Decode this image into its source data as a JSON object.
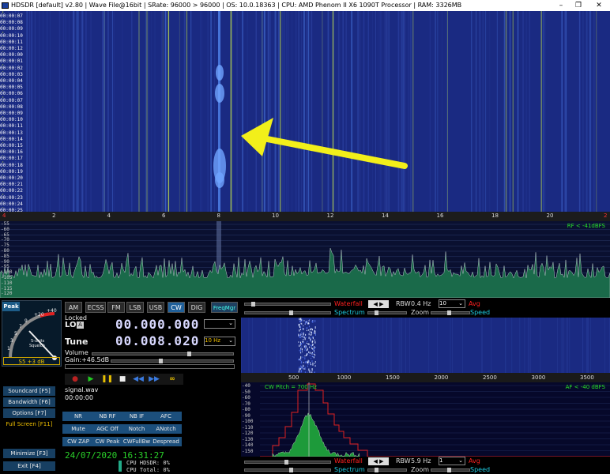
{
  "titlebar": {
    "title": "HDSDR  [default]  v2.80  |  Wave File@16bit  |  SRate: 96000 > 96000  |  OS: 10.0.18363  |  CPU: AMD Phenom II X6 1090T Processor  |  RAM: 3326MB",
    "min": "–",
    "max": "❐",
    "close": "✕"
  },
  "waterfall": {
    "timestamps": [
      "00:00:07",
      "00:00:08",
      "00:00:09",
      "00:00:10",
      "00:00:11",
      "00:00:12",
      "00:00:00",
      "00:00:01",
      "00:00:02",
      "00:00:03",
      "00:00:04",
      "00:00:05",
      "00:00:06",
      "00:00:07",
      "00:00:08",
      "00:00:09",
      "00:00:10",
      "00:00:11",
      "00:00:13",
      "00:00:14",
      "00:00:15",
      "00:00:16",
      "00:00:17",
      "00:00:18",
      "00:00:19",
      "00:00:20",
      "00:00:21",
      "00:00:22",
      "00:00:23",
      "00:00:24",
      "00:00:25"
    ],
    "freq_ticks": [
      "2",
      "4",
      "6",
      "8",
      "10",
      "12",
      "14",
      "16",
      "18",
      "20"
    ],
    "left_marker": "4",
    "right_marker": "2"
  },
  "spectrum": {
    "db_labels": [
      "-55",
      "-60",
      "-65",
      "-70",
      "-75",
      "-80",
      "-85",
      "-90",
      "-95",
      "-100",
      "-105",
      "-110",
      "-115",
      "-120"
    ],
    "rf_info": "RF < -41dBFS"
  },
  "smeter": {
    "peak_label": "Peak",
    "scale": [
      "+40",
      "+20",
      "9",
      "7",
      "5",
      "3",
      "1"
    ],
    "units": "S-units",
    "squelch": "Squelch",
    "reading": "S5 +3 dB"
  },
  "modes": {
    "buttons": [
      "AM",
      "ECSS",
      "FM",
      "LSB",
      "USB",
      "CW",
      "DIG"
    ],
    "active": "CW",
    "freqmgr": "FreqMgr"
  },
  "lo": {
    "locked": "Locked",
    "label": "LO",
    "badge": "A",
    "value": "00.000.000"
  },
  "tune": {
    "label": "Tune",
    "value": "00.008.020",
    "step": "10 Hz"
  },
  "volume": {
    "label": "Volume",
    "gain": "Gain:+46.5dB"
  },
  "playback": {
    "file": "signal.wav",
    "time": "00:00:00"
  },
  "left_buttons": [
    {
      "label": "Soundcard",
      "key": "[F5]"
    },
    {
      "label": "Bandwidth",
      "key": "[F6]"
    },
    {
      "label": "Options",
      "key": "[F7]"
    },
    {
      "label": "Full Screen",
      "key": "[F11]"
    },
    {
      "label": "Minimize",
      "key": "[F3]"
    },
    {
      "label": "Exit",
      "key": "[F4]"
    }
  ],
  "dsp_buttons": [
    [
      "NR",
      "NB RF",
      "NB IF",
      "AFC"
    ],
    [
      "Mute",
      "AGC Off",
      "Notch",
      "ANotch"
    ],
    [
      "CW ZAP",
      "CW Peak",
      "CWFullBw",
      "Despread"
    ]
  ],
  "status": {
    "datetime": "24/07/2020 16:31:27",
    "cpu_hdsdr": "CPU HDSDR:  0%",
    "cpu_total": "CPU Total:  0%"
  },
  "zoom_top": {
    "waterfall": "Waterfall",
    "spectrum": "Spectrum",
    "rbw_label": "RBW",
    "rbw_value": "0.4 Hz",
    "avg_value": "10",
    "avg": "Avg",
    "zoom": "Zoom",
    "speed": "Speed"
  },
  "zoom_axis": [
    "500",
    "1000",
    "1500",
    "2000",
    "2500",
    "3000",
    "3500"
  ],
  "af_spectrum": {
    "cw_pitch": "CW Pitch = 700 Hz",
    "af_info": "AF < -40 dBFS",
    "db_labels": [
      "-40",
      "-50",
      "-60",
      "-70",
      "-80",
      "-90",
      "-100",
      "-110",
      "-120",
      "-130",
      "-140",
      "-150"
    ]
  },
  "zoom_bottom": {
    "waterfall": "Waterfall",
    "spectrum": "Spectrum",
    "rbw_label": "RBW",
    "rbw_value": "5.9 Hz",
    "avg_value": "1",
    "avg": "Avg",
    "zoom": "Zoom",
    "speed": "Speed"
  },
  "colors": {
    "waterfall_bg": "#1a2a82",
    "accent_button": "#1a4f7a",
    "arrow": "#f2ef1a",
    "green_text": "#28e028"
  }
}
